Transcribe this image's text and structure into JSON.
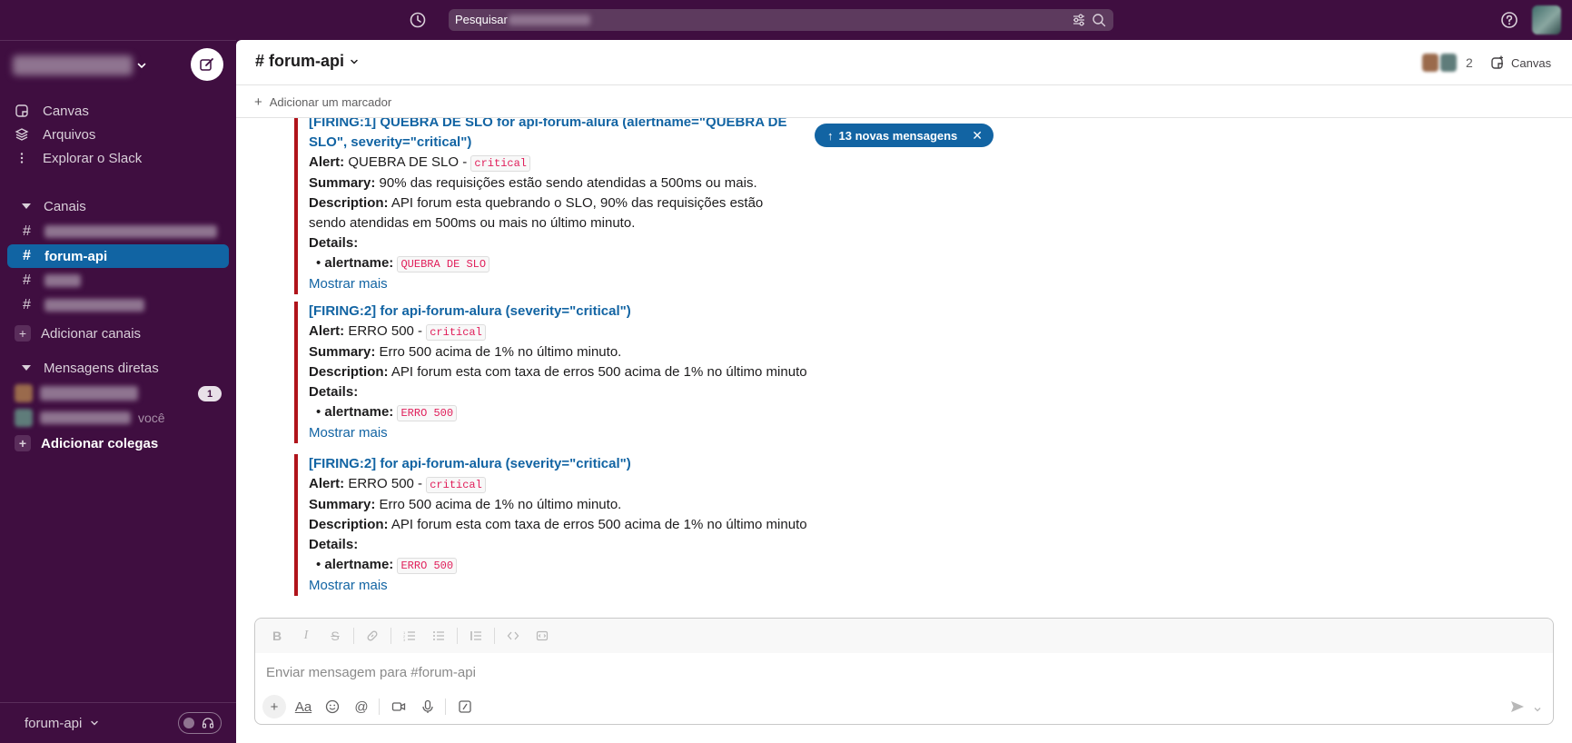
{
  "topbar": {
    "search_label": "Pesquisar",
    "icons": [
      "history-icon",
      "filter-icon",
      "search-icon",
      "help-icon"
    ]
  },
  "sidebar": {
    "nav": [
      {
        "label": "Canvas",
        "icon": "canvas-icon"
      },
      {
        "label": "Arquivos",
        "icon": "files-icon"
      },
      {
        "label": "Explorar o Slack",
        "icon": "more-icon"
      }
    ],
    "channels_heading": "Canais",
    "active_channel": "forum-api",
    "add_channels": "Adicionar canais",
    "dm_heading": "Mensagens diretas",
    "dm_badge": "1",
    "you_label": "você",
    "add_colleagues": "Adicionar colegas",
    "footer_channel": "forum-api"
  },
  "header": {
    "channel_name": "# forum-api",
    "member_count": "2",
    "canvas_label": "Canvas",
    "add_bookmark": "Adicionar um marcador"
  },
  "new_messages_pill": "13 novas mensagens",
  "alerts": [
    {
      "title": "[FIRING:1] QUEBRA DE SLO for api-forum-alura (alertname=\"QUEBRA DE SLO\", severity=\"critical\")",
      "alert_label": "Alert:",
      "alert_value": "QUEBRA DE SLO -",
      "severity": "critical",
      "summary_label": "Summary:",
      "summary": "90% das requisições estão sendo atendidas a 500ms ou mais.",
      "description_label": "Description:",
      "description": "API forum esta quebrando o SLO, 90% das requisições estão sendo atendidas em 500ms ou mais no último minuto.",
      "details_label": "Details:",
      "alertname_label": "alertname:",
      "alertname": "QUEBRA DE SLO",
      "show_more": "Mostrar mais"
    },
    {
      "title": "[FIRING:2]  for api-forum-alura (severity=\"critical\")",
      "alert_label": "Alert:",
      "alert_value": "ERRO 500 -",
      "severity": "critical",
      "summary_label": "Summary:",
      "summary": "Erro 500 acima de 1% no último minuto.",
      "description_label": "Description:",
      "description": "API forum esta com taxa de erros 500 acima de 1% no último minuto",
      "details_label": "Details:",
      "alertname_label": "alertname:",
      "alertname": "ERRO 500",
      "show_more": "Mostrar mais"
    },
    {
      "title": "[FIRING:2]  for api-forum-alura (severity=\"critical\")",
      "alert_label": "Alert:",
      "alert_value": "ERRO 500 -",
      "severity": "critical",
      "summary_label": "Summary:",
      "summary": "Erro 500 acima de 1% no último minuto.",
      "description_label": "Description:",
      "description": "API forum esta com taxa de erros 500 acima de 1% no último minuto",
      "details_label": "Details:",
      "alertname_label": "alertname:",
      "alertname": "ERRO 500",
      "show_more": "Mostrar mais"
    }
  ],
  "composer": {
    "placeholder": "Enviar mensagem para #forum-api",
    "format_label": "Aa"
  },
  "colors": {
    "sidebar": "#3f0e40",
    "active_channel": "#1164a3",
    "link": "#1264a3",
    "alert_bar": "#b0141b",
    "code_text": "#e01e5a"
  }
}
